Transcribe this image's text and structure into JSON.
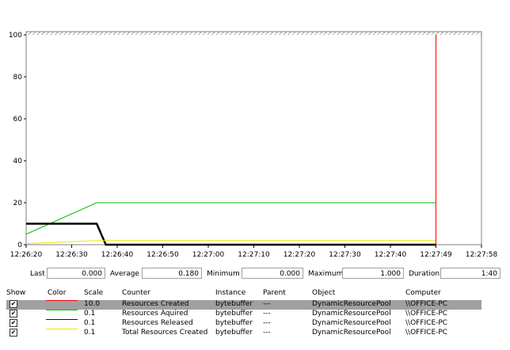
{
  "chart_data": {
    "type": "line",
    "x_ticks": [
      "12:26:20",
      "12:26:30",
      "12:26:40",
      "12:26:50",
      "12:27:00",
      "12:27:10",
      "12:27:20",
      "12:27:30",
      "12:27:40",
      "12:27:49",
      "12:27:58"
    ],
    "y_ticks": [
      "100",
      "80",
      "60",
      "40",
      "20",
      "0"
    ],
    "ylim": [
      0,
      100
    ],
    "grid": false,
    "current_time_index": 9,
    "series": [
      {
        "color": "#ff0000",
        "points": []
      },
      {
        "color": "#00c000",
        "points": [
          [
            0,
            5
          ],
          [
            1.55,
            20
          ],
          [
            2,
            20
          ],
          [
            3,
            20
          ],
          [
            4,
            20
          ],
          [
            5,
            20
          ],
          [
            6,
            20
          ],
          [
            7,
            20
          ],
          [
            8,
            20
          ],
          [
            9,
            20
          ]
        ]
      },
      {
        "color": "#000000",
        "points": [
          [
            0,
            10
          ],
          [
            1.55,
            10
          ],
          [
            1.75,
            0
          ],
          [
            9,
            0
          ]
        ]
      },
      {
        "color": "#e8e800",
        "points": [
          [
            0,
            0.5
          ],
          [
            1.6,
            2
          ],
          [
            2,
            2
          ],
          [
            9,
            2
          ]
        ]
      }
    ]
  },
  "stats": {
    "last_label": "Last",
    "last_value": "0.000",
    "average_label": "Average",
    "average_value": "0.180",
    "minimum_label": "Minimum",
    "minimum_value": "0.000",
    "maximum_label": "Maximum",
    "maximum_value": "1.000",
    "duration_label": "Duration",
    "duration_value": "1:40"
  },
  "legend": {
    "headers": {
      "show": "Show",
      "color": "Color",
      "scale": "Scale",
      "counter": "Counter",
      "instance": "Instance",
      "parent": "Parent",
      "object": "Object",
      "computer": "Computer"
    },
    "rows": [
      {
        "checked": "✔",
        "color": "#ff0000",
        "scale": "10.0",
        "counter": "Resources Created",
        "instance": "bytebuffer",
        "parent": "---",
        "object": "DynamicResourcePool",
        "computer": "\\\\OFFICE-PC"
      },
      {
        "checked": "✔",
        "color": "#00c000",
        "scale": "0.1",
        "counter": "Resources Aquired",
        "instance": "bytebuffer",
        "parent": "---",
        "object": "DynamicResourcePool",
        "computer": "\\\\OFFICE-PC"
      },
      {
        "checked": "✔",
        "color": "#0000c0",
        "scale": "0.1",
        "counter": "Resources Released",
        "instance": "bytebuffer",
        "parent": "---",
        "object": "DynamicResourcePool",
        "computer": "\\\\OFFICE-PC"
      },
      {
        "checked": "✔",
        "color": "#e8e800",
        "scale": "0.1",
        "counter": "Total Resources Created",
        "instance": "bytebuffer",
        "parent": "---",
        "object": "DynamicResourcePool",
        "computer": "\\\\OFFICE-PC"
      }
    ]
  }
}
